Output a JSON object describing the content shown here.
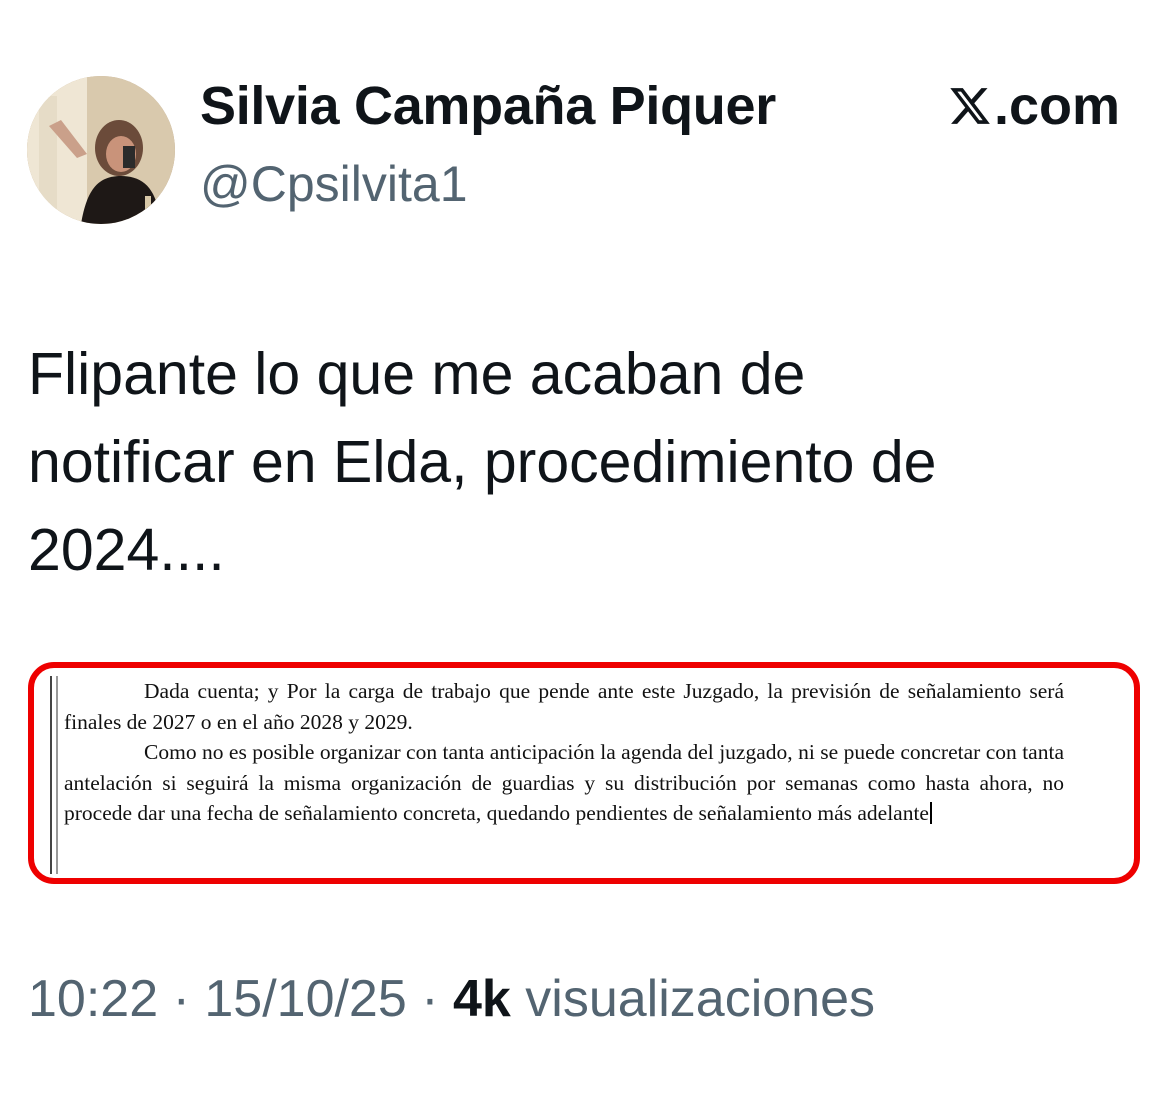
{
  "author": {
    "display_name": "Silvia Campaña Piquer",
    "handle": "@Cpsilvita1",
    "avatar_icon": "profile-photo"
  },
  "brand": {
    "text": ".com",
    "icon": "x-logo-icon"
  },
  "tweet": {
    "text": "Flipante lo que me acaban de\nnotificar en Elda, procedimiento de\n2024...."
  },
  "attachment": {
    "paragraph_1": "Dada cuenta; y Por la carga de trabajo que pende ante este Juzgado, la previsión de señalamiento será finales de 2027 o en el año 2028 y 2029.",
    "paragraph_2": "Como no es posible organizar con tanta anticipación la agenda del juzgado, ni se puede concretar con tanta antelación si seguirá la misma organización de guardias y su distribución por semanas como hasta ahora, no procede dar una fecha de señalamiento concreta, quedando pendientes de señalamiento más adelante",
    "highlight_color": "#ee0000"
  },
  "meta": {
    "time": "10:22",
    "separator": " · ",
    "date": "15/10/25",
    "views_count": "4k",
    "views_label": " visualizaciones"
  },
  "colors": {
    "text_primary": "#0f1419",
    "text_secondary": "#536471"
  }
}
